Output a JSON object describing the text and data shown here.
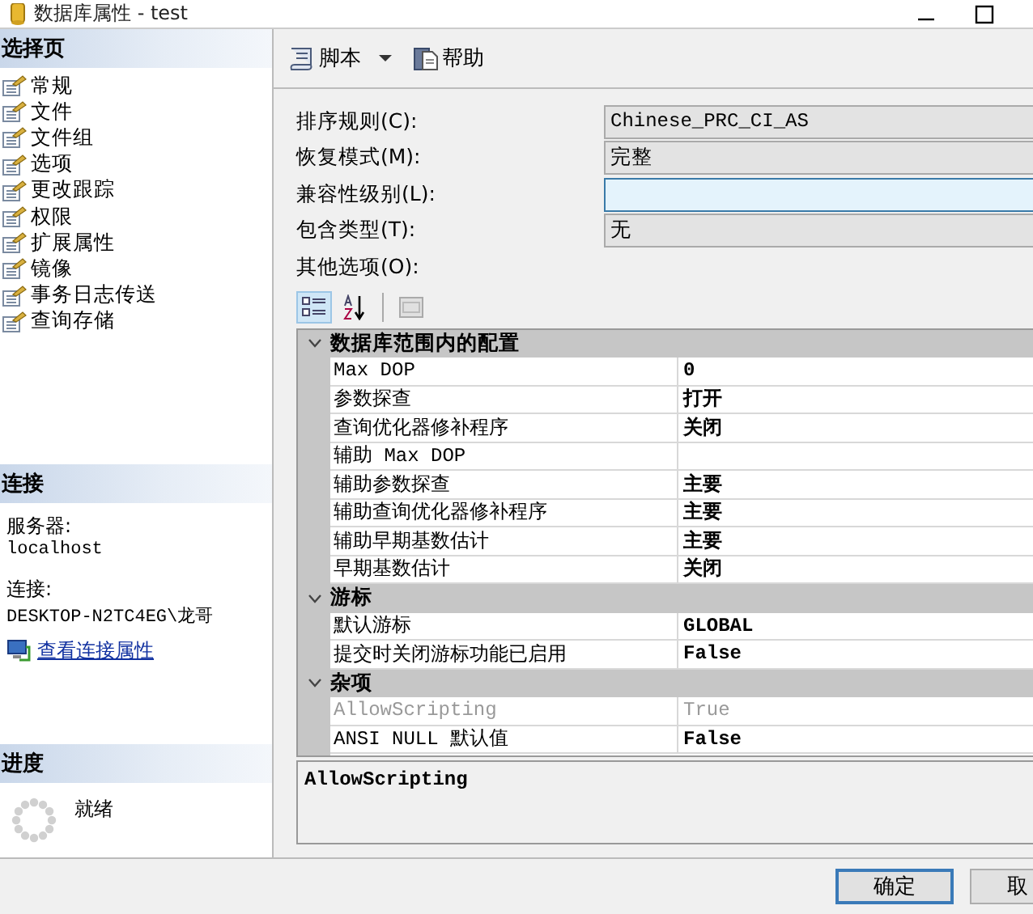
{
  "window": {
    "title": "数据库属性 - test"
  },
  "sidebar": {
    "select_header": "选择页",
    "pages": [
      {
        "label": "常规"
      },
      {
        "label": "文件"
      },
      {
        "label": "文件组"
      },
      {
        "label": "选项"
      },
      {
        "label": "更改跟踪"
      },
      {
        "label": "权限"
      },
      {
        "label": "扩展属性"
      },
      {
        "label": "镜像"
      },
      {
        "label": "事务日志传送"
      },
      {
        "label": "查询存储"
      }
    ],
    "connection": {
      "header": "连接",
      "server_label": "服务器:",
      "server": "localhost",
      "connection_label": "连接:",
      "connection": "DESKTOP-N2TC4EG\\龙哥",
      "link": "查看连接属性"
    },
    "progress": {
      "header": "进度",
      "status": "就绪"
    }
  },
  "toolbar": [
    {
      "kind": "script",
      "label": "脚本"
    },
    {
      "kind": "help",
      "label": "帮助"
    }
  ],
  "form": {
    "fields": [
      {
        "label": "排序规则(C):",
        "value": "Chinese_PRC_CI_AS",
        "focused": false
      },
      {
        "label": "恢复模式(M):",
        "value": "完整",
        "focused": false
      },
      {
        "label": "兼容性级别(L):",
        "focused": true
      },
      {
        "label": "包含类型(T):",
        "value": "无",
        "focused": false
      }
    ],
    "other_options_label": "其他选项(O):"
  },
  "grid_toolbar": [
    {
      "kind": "categorized",
      "selected": true
    },
    {
      "kind": "alphabetical",
      "selected": false
    },
    {
      "kind": "pages",
      "selected": false
    }
  ],
  "grid": {
    "categories": [
      {
        "name": "数据库范围内的配置",
        "expanded": true,
        "properties": [
          {
            "name": "Max DOP",
            "value": "0",
            "readonly": false
          },
          {
            "name": "参数探查",
            "value": "打开",
            "readonly": false
          },
          {
            "name": "查询优化器修补程序",
            "value": "关闭",
            "readonly": false
          },
          {
            "name": "辅助 Max DOP",
            "readonly": false
          },
          {
            "name": "辅助参数探查",
            "value": "主要",
            "readonly": false
          },
          {
            "name": "辅助查询优化器修补程序",
            "value": "主要",
            "readonly": false
          },
          {
            "name": "辅助早期基数估计",
            "value": "主要",
            "readonly": false
          },
          {
            "name": "早期基数估计",
            "value": "关闭",
            "readonly": false
          }
        ]
      },
      {
        "name": "游标",
        "expanded": true,
        "properties": [
          {
            "name": "默认游标",
            "value": "GLOBAL",
            "readonly": false
          },
          {
            "name": "提交时关闭游标功能已启用",
            "value": "False",
            "readonly": false
          }
        ]
      },
      {
        "name": "杂项",
        "expanded": true,
        "properties": [
          {
            "name": "AllowScripting",
            "value": "True",
            "readonly": true
          },
          {
            "name": "ANSI NULL 默认值",
            "value": "False",
            "readonly": false
          }
        ]
      }
    ]
  },
  "description": {
    "title": "AllowScripting"
  },
  "buttons": [
    {
      "label": "确定",
      "default": true
    },
    {
      "label": "取",
      "default": false
    }
  ]
}
